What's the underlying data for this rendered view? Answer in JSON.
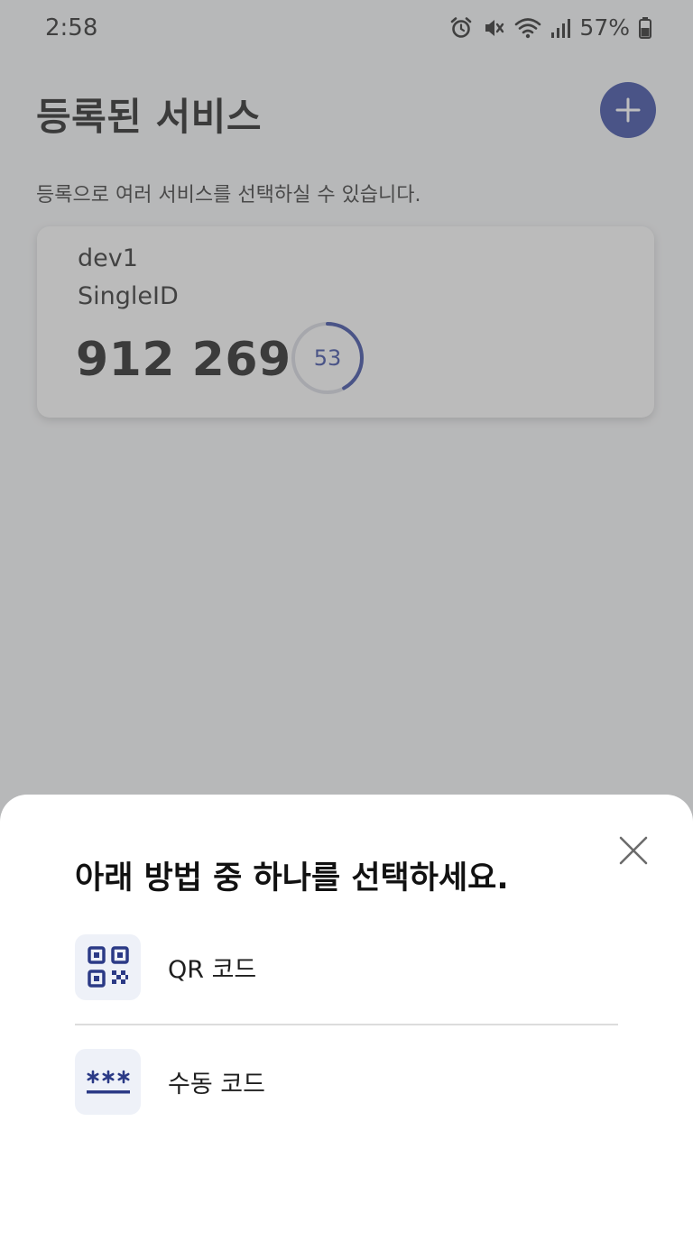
{
  "status_bar": {
    "time": "2:58",
    "battery": "57%",
    "icons": [
      "alarm-icon",
      "mute-icon",
      "wifi-icon",
      "signal-icon",
      "battery-icon"
    ]
  },
  "header": {
    "title": "등록된 서비스",
    "subtitle": "등록으로 여러 서비스를 선택하실 수 있습니다.",
    "add_icon": "plus-icon"
  },
  "service_card": {
    "account": "dev1",
    "issuer": "SingleID",
    "code": "912 269",
    "seconds_remaining": "53",
    "timer_fraction": 0.42
  },
  "bottom_sheet": {
    "title": "아래 방법 중 하나를 선택하세요.",
    "close_icon": "close-icon",
    "options": [
      {
        "label": "QR 코드",
        "icon": "qr-code-icon"
      },
      {
        "label": "수동 코드",
        "icon": "asterisk-code-icon"
      }
    ]
  },
  "colors": {
    "accent": "#2c3e9c",
    "background": "#f3f4f6",
    "sheet": "#ffffff"
  }
}
